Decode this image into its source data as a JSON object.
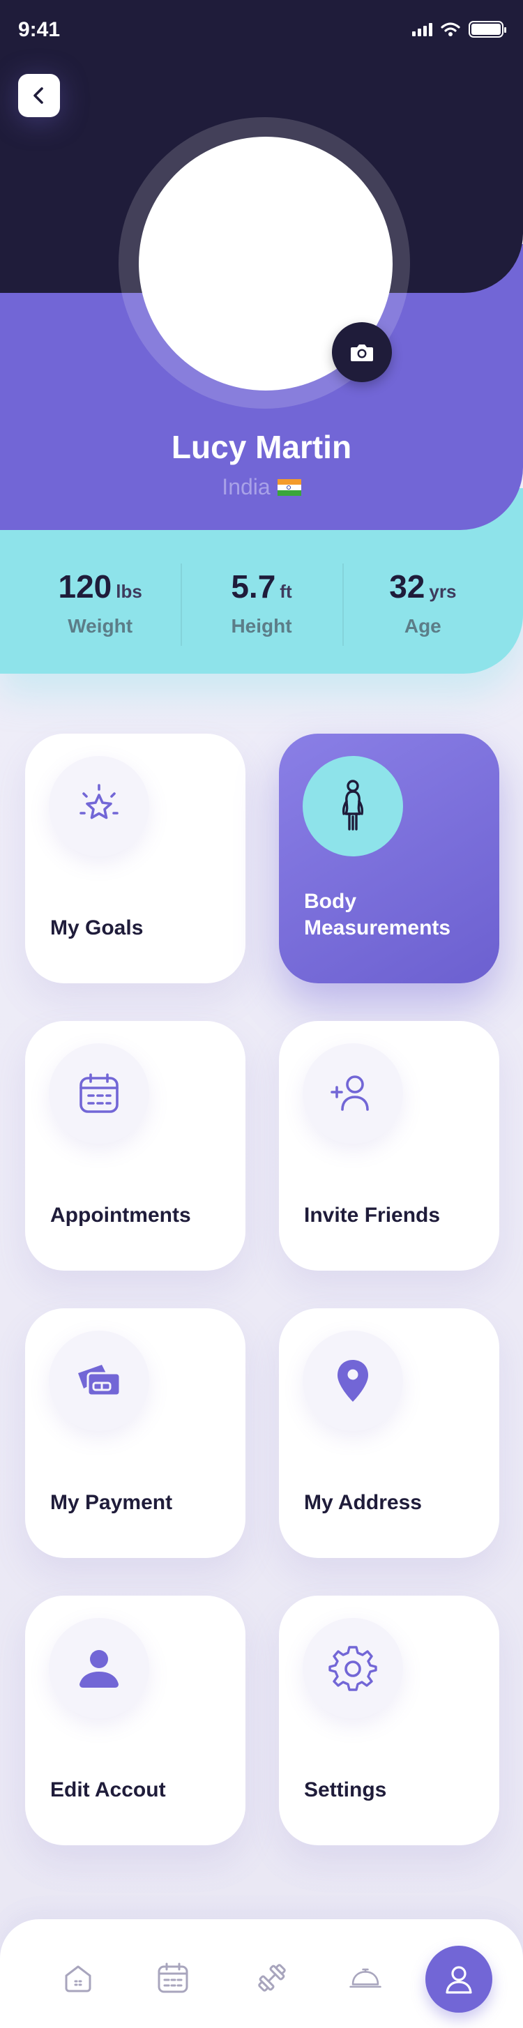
{
  "status_bar": {
    "time": "9:41",
    "icons": [
      "signal-icon",
      "wifi-icon",
      "battery-icon"
    ]
  },
  "header": {
    "back_icon": "chevron-left-icon",
    "camera_icon": "camera-icon",
    "name": "Lucy Martin",
    "country": "India",
    "flag_icon": "india-flag-icon"
  },
  "stats": [
    {
      "value": "120",
      "unit": "lbs",
      "label": "Weight"
    },
    {
      "value": "5.7",
      "unit": "ft",
      "label": "Height"
    },
    {
      "value": "32",
      "unit": "yrs",
      "label": "Age"
    }
  ],
  "menu": [
    {
      "label": "My Goals",
      "icon": "star-icon",
      "active": false
    },
    {
      "label": "Body Measurements",
      "icon": "body-icon",
      "active": true
    },
    {
      "label": "Appointments",
      "icon": "calendar-icon",
      "active": false
    },
    {
      "label": "Invite Friends",
      "icon": "add-user-icon",
      "active": false
    },
    {
      "label": "My Payment",
      "icon": "credit-card-icon",
      "active": false
    },
    {
      "label": "My Address",
      "icon": "location-pin-icon",
      "active": false
    },
    {
      "label": "Edit Accout",
      "icon": "user-icon",
      "active": false
    },
    {
      "label": "Settings",
      "icon": "gear-icon",
      "active": false
    }
  ],
  "tabbar": {
    "items": [
      "home-icon",
      "calendar-icon",
      "dumbbell-icon",
      "cloche-icon",
      "profile-icon"
    ],
    "active": "profile-icon"
  },
  "colors": {
    "dark": "#1f1c3a",
    "purple": "#7266d6",
    "cyan": "#8ee3ea",
    "background": "#efedf8"
  }
}
